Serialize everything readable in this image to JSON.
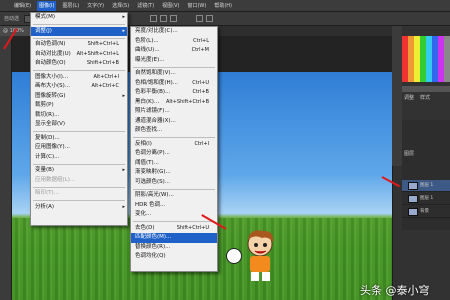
{
  "menubar": {
    "items": [
      "",
      "编辑(E)",
      "图像(I)",
      "图层(L)",
      "文字(Y)",
      "选择(S)",
      "滤镜(T)",
      "视图(V)",
      "窗口(W)",
      "帮助(H)"
    ],
    "active_index": 2
  },
  "options_bar": {
    "label": "自动选"
  },
  "doc_tab": {
    "label": "@ 100%"
  },
  "image_menu": {
    "items": [
      {
        "label": "模式(M)",
        "shortcut": "",
        "submenu": true
      },
      {
        "sep": true
      },
      {
        "label": "调整(J)",
        "shortcut": "",
        "submenu": true,
        "highlighted": true
      },
      {
        "sep": true
      },
      {
        "label": "自动色调(N)",
        "shortcut": "Shift+Ctrl+L"
      },
      {
        "label": "自动对比度(U)",
        "shortcut": "Alt+Shift+Ctrl+L"
      },
      {
        "label": "自动颜色(O)",
        "shortcut": "Shift+Ctrl+B"
      },
      {
        "sep": true
      },
      {
        "label": "图像大小(I)...",
        "shortcut": "Alt+Ctrl+I"
      },
      {
        "label": "画布大小(S)...",
        "shortcut": "Alt+Ctrl+C"
      },
      {
        "label": "图像旋转(G)",
        "shortcut": "",
        "submenu": true
      },
      {
        "label": "裁剪(P)",
        "shortcut": ""
      },
      {
        "label": "裁切(R)...",
        "shortcut": ""
      },
      {
        "label": "显示全部(V)",
        "shortcut": ""
      },
      {
        "sep": true
      },
      {
        "label": "复制(D)...",
        "shortcut": ""
      },
      {
        "label": "应用图像(Y)...",
        "shortcut": ""
      },
      {
        "label": "计算(C)...",
        "shortcut": ""
      },
      {
        "sep": true
      },
      {
        "label": "变量(B)",
        "shortcut": "",
        "submenu": true
      },
      {
        "label": "应用数据组(L)...",
        "shortcut": "",
        "disabled": true
      },
      {
        "sep": true
      },
      {
        "label": "陷印(T)...",
        "shortcut": "",
        "disabled": true
      },
      {
        "sep": true
      },
      {
        "label": "分析(A)",
        "shortcut": "",
        "submenu": true
      }
    ]
  },
  "adjust_menu": {
    "items": [
      {
        "label": "亮度/对比度(C)...",
        "shortcut": ""
      },
      {
        "label": "色阶(L)...",
        "shortcut": "Ctrl+L"
      },
      {
        "label": "曲线(U)...",
        "shortcut": "Ctrl+M"
      },
      {
        "label": "曝光度(E)...",
        "shortcut": ""
      },
      {
        "sep": true
      },
      {
        "label": "自然饱和度(V)...",
        "shortcut": ""
      },
      {
        "label": "色相/饱和度(H)...",
        "shortcut": "Ctrl+U"
      },
      {
        "label": "色彩平衡(B)...",
        "shortcut": "Ctrl+B"
      },
      {
        "label": "黑白(K)...",
        "shortcut": "Alt+Shift+Ctrl+B"
      },
      {
        "label": "照片滤镜(F)...",
        "shortcut": ""
      },
      {
        "label": "通道混合器(X)...",
        "shortcut": ""
      },
      {
        "label": "颜色查找...",
        "shortcut": ""
      },
      {
        "sep": true
      },
      {
        "label": "反相(I)",
        "shortcut": "Ctrl+I"
      },
      {
        "label": "色调分离(P)...",
        "shortcut": ""
      },
      {
        "label": "阈值(T)...",
        "shortcut": ""
      },
      {
        "label": "渐变映射(G)...",
        "shortcut": ""
      },
      {
        "label": "可选颜色(S)...",
        "shortcut": ""
      },
      {
        "sep": true
      },
      {
        "label": "阴影/高光(W)...",
        "shortcut": ""
      },
      {
        "label": "HDR 色调...",
        "shortcut": ""
      },
      {
        "label": "变化...",
        "shortcut": ""
      },
      {
        "sep": true
      },
      {
        "label": "去色(D)",
        "shortcut": "Shift+Ctrl+U"
      },
      {
        "label": "匹配颜色(M)...",
        "shortcut": "",
        "highlighted": true
      },
      {
        "label": "替换颜色(R)...",
        "shortcut": ""
      },
      {
        "label": "色调均化(Q)",
        "shortcut": ""
      }
    ]
  },
  "layers_panel": {
    "tab": "图层",
    "layers": [
      "图层 1",
      "图层 1",
      "背景"
    ]
  },
  "right_panel_labels": {
    "adjust": "调整",
    "styles": "样式"
  },
  "watermark": "头条 @泰小穹",
  "colors": {
    "highlight": "#1f61c7",
    "arrow": "#e0191a"
  }
}
